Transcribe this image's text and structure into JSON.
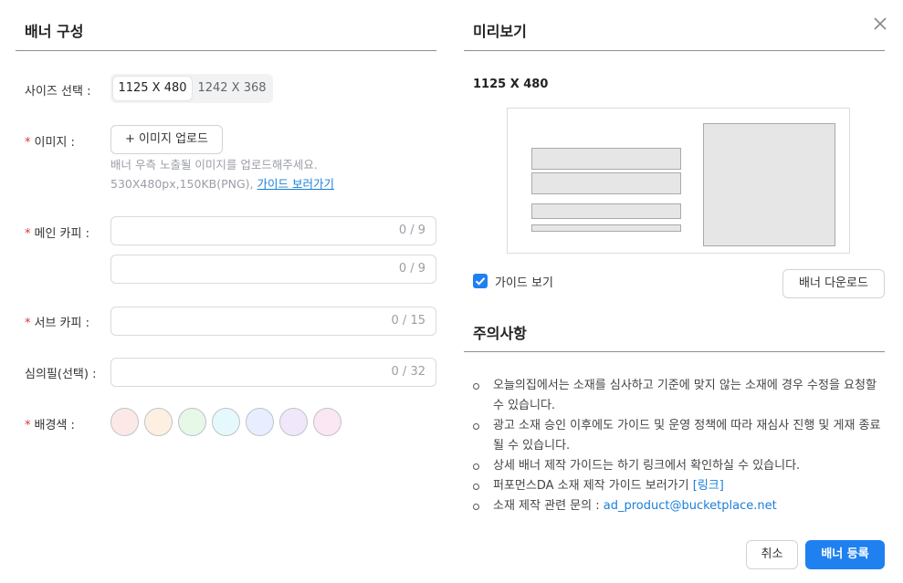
{
  "left": {
    "title": "배너 구성",
    "size": {
      "label": "사이즈 선택 :",
      "options": [
        "1125 X 480",
        "1242 X 368"
      ],
      "selected": "1125 X 480"
    },
    "image": {
      "label": "이미지 :",
      "upload_button": "+ 이미지 업로드",
      "hint_line1": "배너 우측 노출될 이미지를 업로드해주세요.",
      "hint_line2": "530X480px,150KB(PNG), ",
      "guide_link": "가이드 보러가기"
    },
    "main_copy": {
      "label": "메인 카피 :",
      "line1": {
        "value": "",
        "counter": "0 / 9"
      },
      "line2": {
        "value": "",
        "counter": "0 / 9"
      }
    },
    "sub_copy": {
      "label": "서브 카피 :",
      "value": "",
      "counter": "0 / 15"
    },
    "seal": {
      "label": "심의필(선택) :",
      "value": "",
      "counter": "0 / 32"
    },
    "bg_color": {
      "label": "배경색 :",
      "swatches": [
        "#fde8e8",
        "#fdf0e2",
        "#e6f8e6",
        "#e5f8fb",
        "#e8eeff",
        "#f1e7fb",
        "#fbe7f3"
      ]
    }
  },
  "right": {
    "title": "미리보기",
    "size_text": "1125 X 480",
    "guide_checkbox": {
      "label": "가이드 보기",
      "checked": true
    },
    "download_button": "배너 다운로드",
    "notice": {
      "title": "주의사항",
      "items": [
        "오늘의집에서는 소재를 심사하고 기준에 맞지 않는 소재에 경우 수정을 요청할 수 있습니다.",
        "광고 소재 승인 이후에도 가이드 및 운영 정책에 따라 재심사 진행 및 게재 종료될 수 있습니다.",
        "상세 배너 제작 가이드는 하기 링크에서 확인하실 수 있습니다.",
        "퍼포먼스DA 소재 제작 가이드 보러가기 "
      ],
      "link_text": "[링크]",
      "contact_label": "소재 제작 관련 문의 : ",
      "contact_email": "ad_product@bucketplace.net"
    }
  },
  "footer": {
    "cancel": "취소",
    "submit": "배너 등록"
  },
  "icons": {
    "close": "close-icon",
    "check": "check-icon"
  },
  "colors": {
    "accent": "#1a7fd9",
    "primary_button": "#1f80f0",
    "required": "#e0323c"
  }
}
